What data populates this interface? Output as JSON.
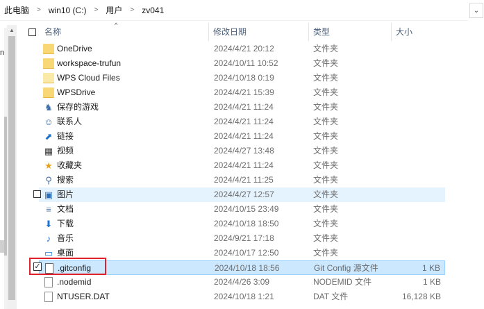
{
  "address": {
    "crumbs": [
      "此电脑",
      "win10 (C:)",
      "用户",
      "zv041"
    ],
    "dropdown": "⌄"
  },
  "nav": {
    "edge_char": "n"
  },
  "columns": {
    "name": "名称",
    "date": "修改日期",
    "type": "类型",
    "size": "大小"
  },
  "rows": [
    {
      "name": "OneDrive",
      "date": "2024/4/21 20:12",
      "type": "文件夹",
      "size": "",
      "icon": "folder-icon"
    },
    {
      "name": "workspace-trufun",
      "date": "2024/10/11 10:52",
      "type": "文件夹",
      "size": "",
      "icon": "folder-icon"
    },
    {
      "name": "WPS Cloud Files",
      "date": "2024/10/18 0:19",
      "type": "文件夹",
      "size": "",
      "icon": "folder-icon"
    },
    {
      "name": "WPSDrive",
      "date": "2024/4/21 15:39",
      "type": "文件夹",
      "size": "",
      "icon": "folder-icon"
    },
    {
      "name": "保存的游戏",
      "date": "2024/4/21 11:24",
      "type": "文件夹",
      "size": "",
      "icon": "saved-games-icon"
    },
    {
      "name": "联系人",
      "date": "2024/4/21 11:24",
      "type": "文件夹",
      "size": "",
      "icon": "contacts-icon"
    },
    {
      "name": "链接",
      "date": "2024/4/21 11:24",
      "type": "文件夹",
      "size": "",
      "icon": "links-icon"
    },
    {
      "name": "视频",
      "date": "2024/4/27 13:48",
      "type": "文件夹",
      "size": "",
      "icon": "videos-icon"
    },
    {
      "name": "收藏夹",
      "date": "2024/4/21 11:24",
      "type": "文件夹",
      "size": "",
      "icon": "favorites-icon"
    },
    {
      "name": "搜索",
      "date": "2024/4/21 11:25",
      "type": "文件夹",
      "size": "",
      "icon": "searches-icon"
    },
    {
      "name": "图片",
      "date": "2024/4/27 12:57",
      "type": "文件夹",
      "size": "",
      "icon": "pictures-icon"
    },
    {
      "name": "文档",
      "date": "2024/10/15 23:49",
      "type": "文件夹",
      "size": "",
      "icon": "documents-icon"
    },
    {
      "name": "下载",
      "date": "2024/10/18 18:50",
      "type": "文件夹",
      "size": "",
      "icon": "downloads-icon"
    },
    {
      "name": "音乐",
      "date": "2024/9/21 17:18",
      "type": "文件夹",
      "size": "",
      "icon": "music-icon"
    },
    {
      "name": "桌面",
      "date": "2024/10/17 12:50",
      "type": "文件夹",
      "size": "",
      "icon": "desktop-icon"
    },
    {
      "name": ".gitconfig",
      "date": "2024/10/18 18:56",
      "type": "Git Config 源文件",
      "size": "1 KB",
      "icon": "gitconfig-file-icon"
    },
    {
      "name": ".nodemid",
      "date": "2024/4/26 3:09",
      "type": "NODEMID 文件",
      "size": "1 KB",
      "icon": "file-icon"
    },
    {
      "name": "NTUSER.DAT",
      "date": "2024/10/18 1:21",
      "type": "DAT 文件",
      "size": "16,128 KB",
      "icon": "file-icon"
    }
  ],
  "glyphs": {
    "check": "✓",
    "sort_up": "^"
  }
}
